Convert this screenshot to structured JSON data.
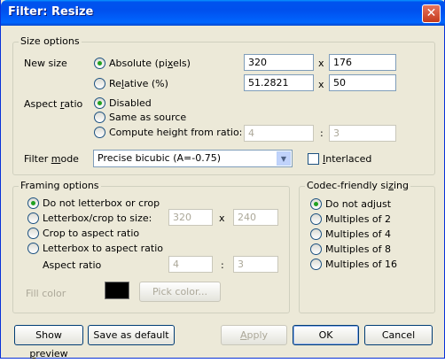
{
  "window": {
    "title": "Filter: Resize"
  },
  "size_options": {
    "title": "Size options",
    "new_size_label": "New size",
    "absolute_label": "Absolute (pixels)",
    "relative_label": "Relative (%)",
    "abs_width": "320",
    "abs_height": "176",
    "rel_width": "51.2821",
    "rel_height": "50",
    "x_sep": "x",
    "aspect_ratio_label": "Aspect ratio",
    "disabled_label": "Disabled",
    "same_as_source_label": "Same as source",
    "compute_height_label": "Compute height from ratio:",
    "ratio_a": "4",
    "ratio_b": "3",
    "colon": ":",
    "filter_mode_label": "Filter mode",
    "filter_mode_value": "Precise bicubic (A=-0.75)",
    "interlaced_label": "Interlaced"
  },
  "framing": {
    "title": "Framing options",
    "do_not_letterbox": "Do not letterbox or crop",
    "letterbox_to_size": "Letterbox/crop to size:",
    "box_width": "320",
    "box_height": "240",
    "x_sep": "x",
    "crop_to_aspect": "Crop to aspect ratio",
    "letterbox_to_aspect": "Letterbox to aspect ratio",
    "aspect_ratio_label": "Aspect ratio",
    "aspect_a": "4",
    "aspect_b": "3",
    "colon": ":",
    "fill_color_label": "Fill color",
    "pick_color_label": "Pick color...",
    "fill_color": "#000000"
  },
  "codec": {
    "title": "Codec-friendly sizing",
    "options": [
      "Do not adjust",
      "Multiples of 2",
      "Multiples of 4",
      "Multiples of 8",
      "Multiples of 16"
    ]
  },
  "buttons": {
    "show_preview": "Show preview",
    "save_default": "Save as default",
    "apply": "Apply",
    "ok": "OK",
    "cancel": "Cancel"
  }
}
